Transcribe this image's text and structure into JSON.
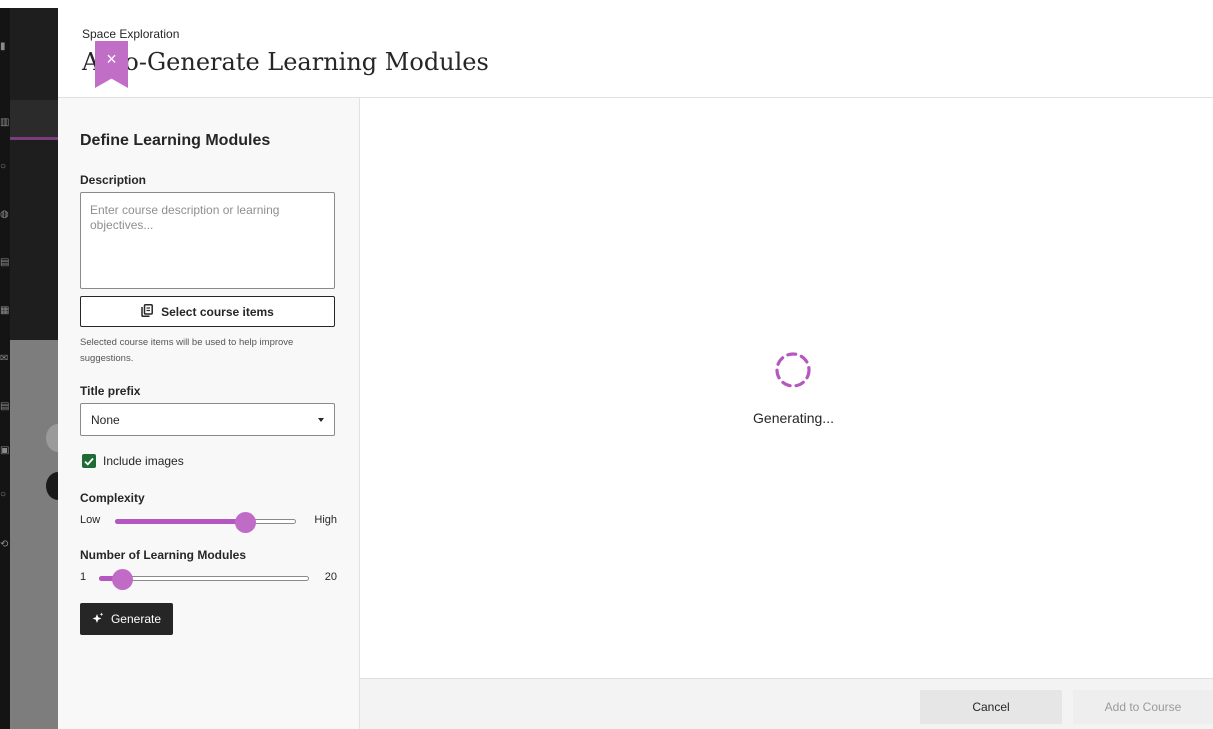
{
  "panel": {
    "course_name": "Space Exploration",
    "title": "Auto-Generate Learning Modules",
    "close_glyph": "×"
  },
  "form": {
    "section_title": "Define Learning Modules",
    "description_label": "Description",
    "description_placeholder": "Enter course description or learning objectives...",
    "description_value": "",
    "select_items_label": "Select course items",
    "select_items_icon": "copy-documents-icon",
    "help_text": "Selected course items will be used to help improve suggestions.",
    "title_prefix_label": "Title prefix",
    "title_prefix_value": "None",
    "include_images_label": "Include images",
    "include_images_checked": true,
    "complexity_label": "Complexity",
    "complexity_min": "Low",
    "complexity_max": "High",
    "complexity_value_fraction": 0.72,
    "modules_label": "Number of Learning Modules",
    "modules_min": "1",
    "modules_max": "20",
    "modules_value": 3,
    "generate_label": "Generate",
    "generate_icon": "sparkle-icon"
  },
  "main": {
    "status_text": "Generating..."
  },
  "footer": {
    "cancel_label": "Cancel",
    "add_label": "Add to Course"
  },
  "colors": {
    "accent": "#c06cc7",
    "accent_dark": "#b457bf",
    "checkbox": "#1f6b33",
    "primary_button": "#262626"
  }
}
